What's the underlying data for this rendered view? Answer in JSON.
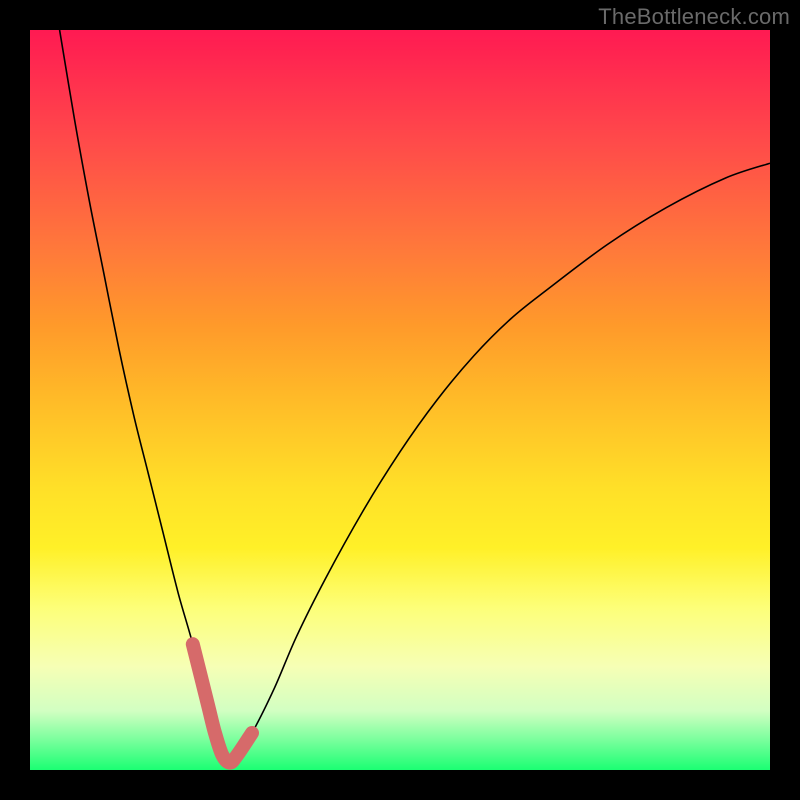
{
  "watermark": "TheBottleneck.com",
  "colors": {
    "bg": "#000000",
    "curve": "#000000",
    "highlight": "#d66a6a",
    "gradient_top": "#ff1a52",
    "gradient_bottom": "#1bff73"
  },
  "chart_data": {
    "type": "line",
    "title": "",
    "xlabel": "",
    "ylabel": "",
    "x_range": [
      0,
      100
    ],
    "y_range": [
      0,
      100
    ],
    "grid": false,
    "legend": false,
    "series": [
      {
        "name": "curve",
        "x": [
          4,
          6,
          8,
          10,
          12,
          14,
          16,
          18,
          20,
          22,
          24,
          25,
          26,
          27,
          28,
          30,
          33,
          36,
          40,
          45,
          50,
          55,
          60,
          65,
          70,
          78,
          86,
          94,
          100
        ],
        "y": [
          100,
          88,
          77,
          67,
          57,
          48,
          40,
          32,
          24,
          17,
          9,
          5,
          2,
          1,
          2,
          5,
          11,
          18,
          26,
          35,
          43,
          50,
          56,
          61,
          65,
          71,
          76,
          80,
          82
        ]
      }
    ],
    "highlight_range_x": [
      22,
      31
    ],
    "notes": "V-shaped bottleneck curve over rainbow gradient; minimum near x≈27. Values estimated from pixels; no axes/ticks shown."
  }
}
